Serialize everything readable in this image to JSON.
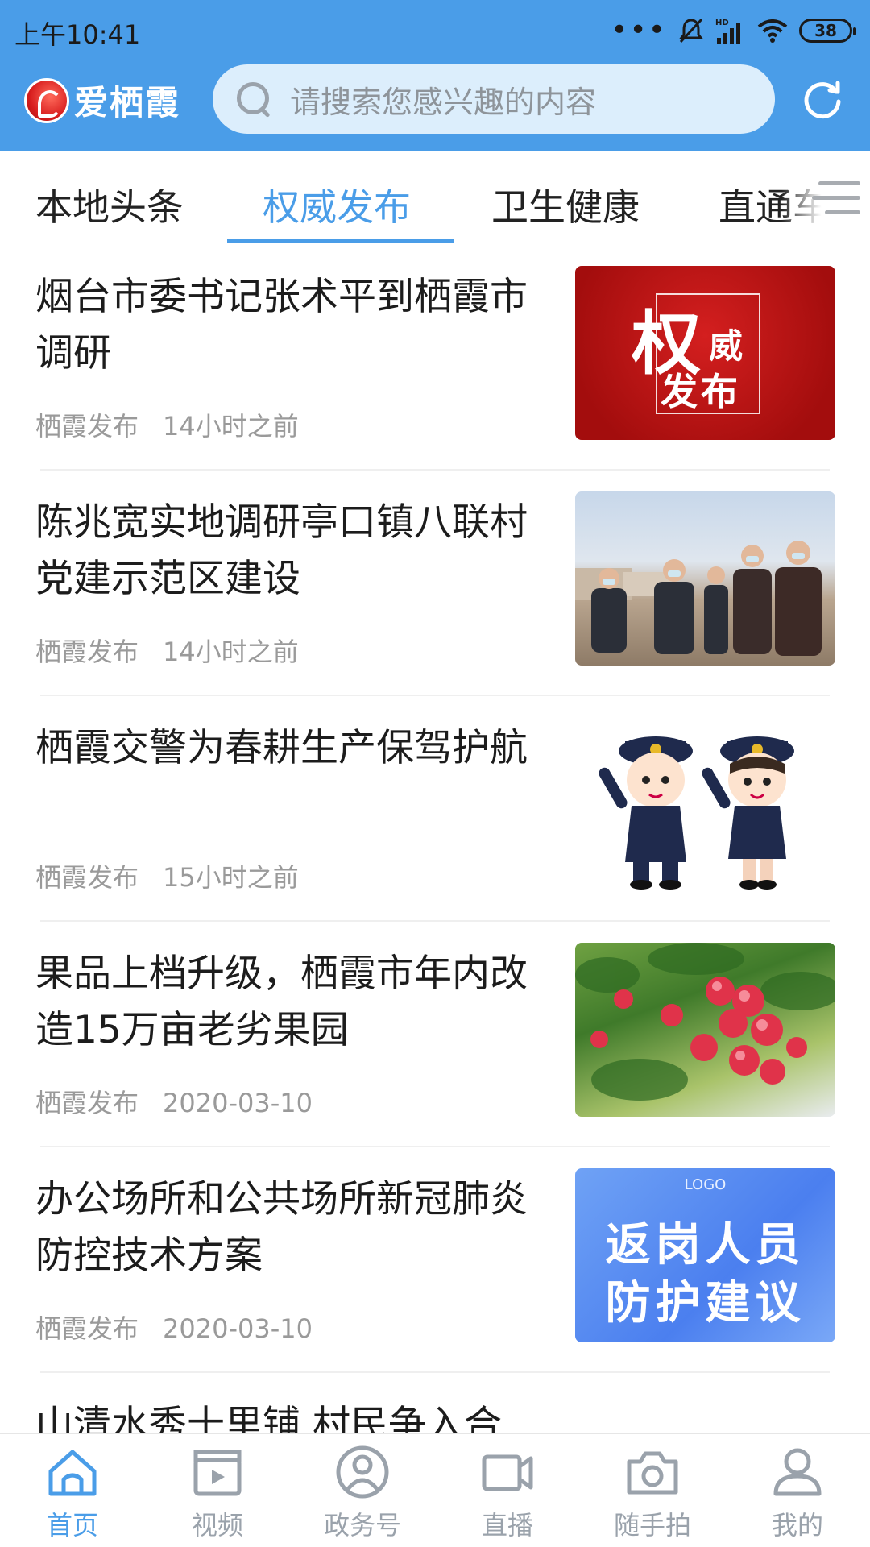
{
  "status_bar": {
    "time": "上午10:41",
    "dots": "•••",
    "battery": "38"
  },
  "app": {
    "logo_text": "爱栖霞"
  },
  "search": {
    "placeholder": "请搜索您感兴趣的内容"
  },
  "tabs": [
    {
      "label": "本地头条",
      "active": false
    },
    {
      "label": "权威发布",
      "active": true
    },
    {
      "label": "卫生健康",
      "active": false
    },
    {
      "label": "直通车",
      "active": false
    }
  ],
  "news": [
    {
      "title": "烟台市委书记张术平到栖霞市调研",
      "source": "栖霞发布",
      "time": "14小时之前",
      "thumb_big": "权",
      "thumb_small1": "威",
      "thumb_small2": "发布"
    },
    {
      "title": "陈兆宽实地调研亭口镇八联村党建示范区建设",
      "source": "栖霞发布",
      "time": "14小时之前"
    },
    {
      "title": "栖霞交警为春耕生产保驾护航",
      "source": "栖霞发布",
      "time": "15小时之前"
    },
    {
      "title": "果品上档升级，栖霞市年内改造15万亩老劣果园",
      "source": "栖霞发布",
      "time": "2020-03-10"
    },
    {
      "title": "办公场所和公共场所新冠肺炎防控技术方案",
      "source": "栖霞发布",
      "time": "2020-03-10",
      "thumb_logo": "LOGO",
      "thumb_line1": "返岗人员",
      "thumb_line2": "防护建议"
    },
    {
      "title": "山清水秀十里铺 村民争入合"
    }
  ],
  "bottom_nav": [
    {
      "label": "首页",
      "icon": "home-icon",
      "active": true
    },
    {
      "label": "视频",
      "icon": "video-icon",
      "active": false
    },
    {
      "label": "政务号",
      "icon": "gov-account-icon",
      "active": false
    },
    {
      "label": "直播",
      "icon": "live-icon",
      "active": false
    },
    {
      "label": "随手拍",
      "icon": "camera-icon",
      "active": false
    },
    {
      "label": "我的",
      "icon": "profile-icon",
      "active": false
    }
  ],
  "colors": {
    "brand": "#4a9de8",
    "nav_inactive": "#9aa2ab"
  }
}
